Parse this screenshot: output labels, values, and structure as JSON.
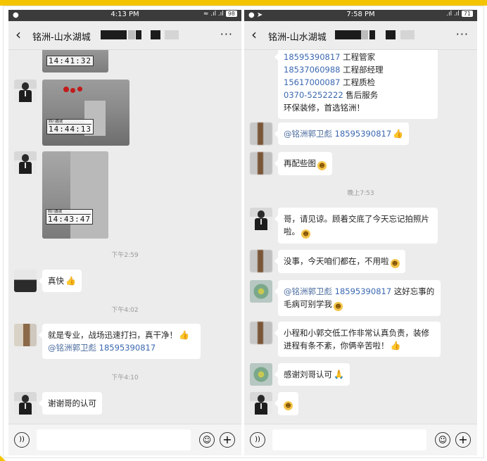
{
  "left": {
    "status": {
      "time": "4:13 PM",
      "battery": "98"
    },
    "title": "铭洲-山水湖城",
    "photos": [
      {
        "stamp_time": "14:41:32"
      },
      {
        "stamp_top": "四川鑫城",
        "stamp_time": "14:44:13"
      },
      {
        "stamp_top": "四川鑫城",
        "stamp_time": "14:43:47"
      }
    ],
    "messages": {
      "ts1": "下午2:59",
      "m1": "真快",
      "ts2": "下午4:02",
      "m2_line1": "就是专业，战场迅速打扫，真干净！",
      "m2_mention": "@铭洲郭卫彪",
      "m2_phone": "18595390817",
      "ts3": "下午4:10",
      "m3": "谢谢哥的认可"
    }
  },
  "right": {
    "status": {
      "time": "7:58 PM",
      "battery": "71"
    },
    "title": "铭洲-山水湖城",
    "contact_card": [
      {
        "number": "18595390817",
        "label": "工程管家"
      },
      {
        "number": "18537060988",
        "label": "工程部经理"
      },
      {
        "number": "15617000087",
        "label": "工程质检"
      },
      {
        "number": "0370-5252222",
        "label": "售后服务"
      }
    ],
    "contact_slogan": "环保装修，首选铭洲！",
    "messages": {
      "r1_mention": "@铭洲郭卫彪",
      "r1_phone": "18595390817",
      "r2": "再配些图",
      "ts1": "晚上7:53",
      "r3": "哥，请见谅。顾着交底了今天忘记拍照片啦。",
      "r4": "没事，今天咱们都在，不用啦",
      "r5_mention": "@铭洲郭卫彪",
      "r5_phone": "18595390817",
      "r5_text1": "这好忘事的",
      "r5_text2": "毛病可别学我",
      "r6": "小程和小郭交低工作非常认真负责，装修进程有条不紊，你俩辛苦啦！",
      "r7": "感谢刘哥认可"
    }
  }
}
